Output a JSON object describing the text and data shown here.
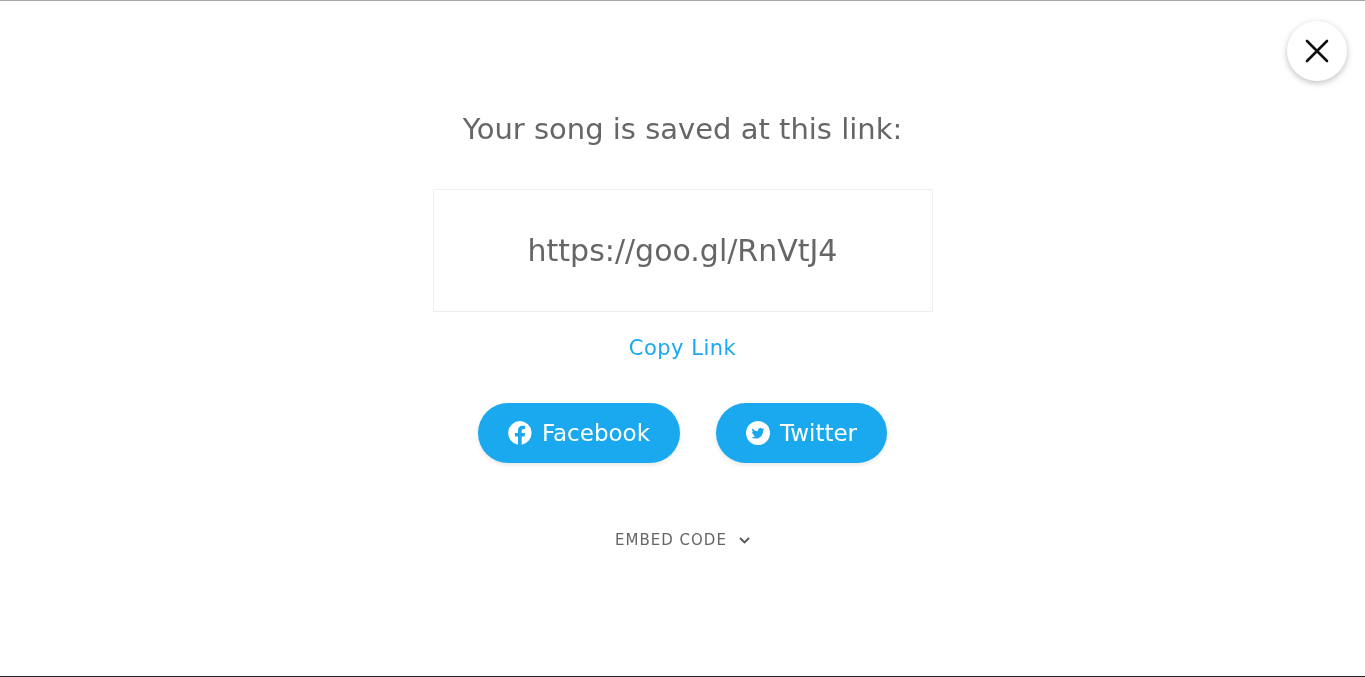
{
  "heading": "Your song is saved at this link:",
  "link": {
    "value": "https://goo.gl/RnVtJ4"
  },
  "copy_link": "Copy Link",
  "share_buttons": [
    {
      "kind": "facebook",
      "label": "Facebook"
    },
    {
      "kind": "twitter",
      "label": "Twitter"
    }
  ],
  "embed_code": {
    "label": "EMBED CODE",
    "expanded": false
  }
}
